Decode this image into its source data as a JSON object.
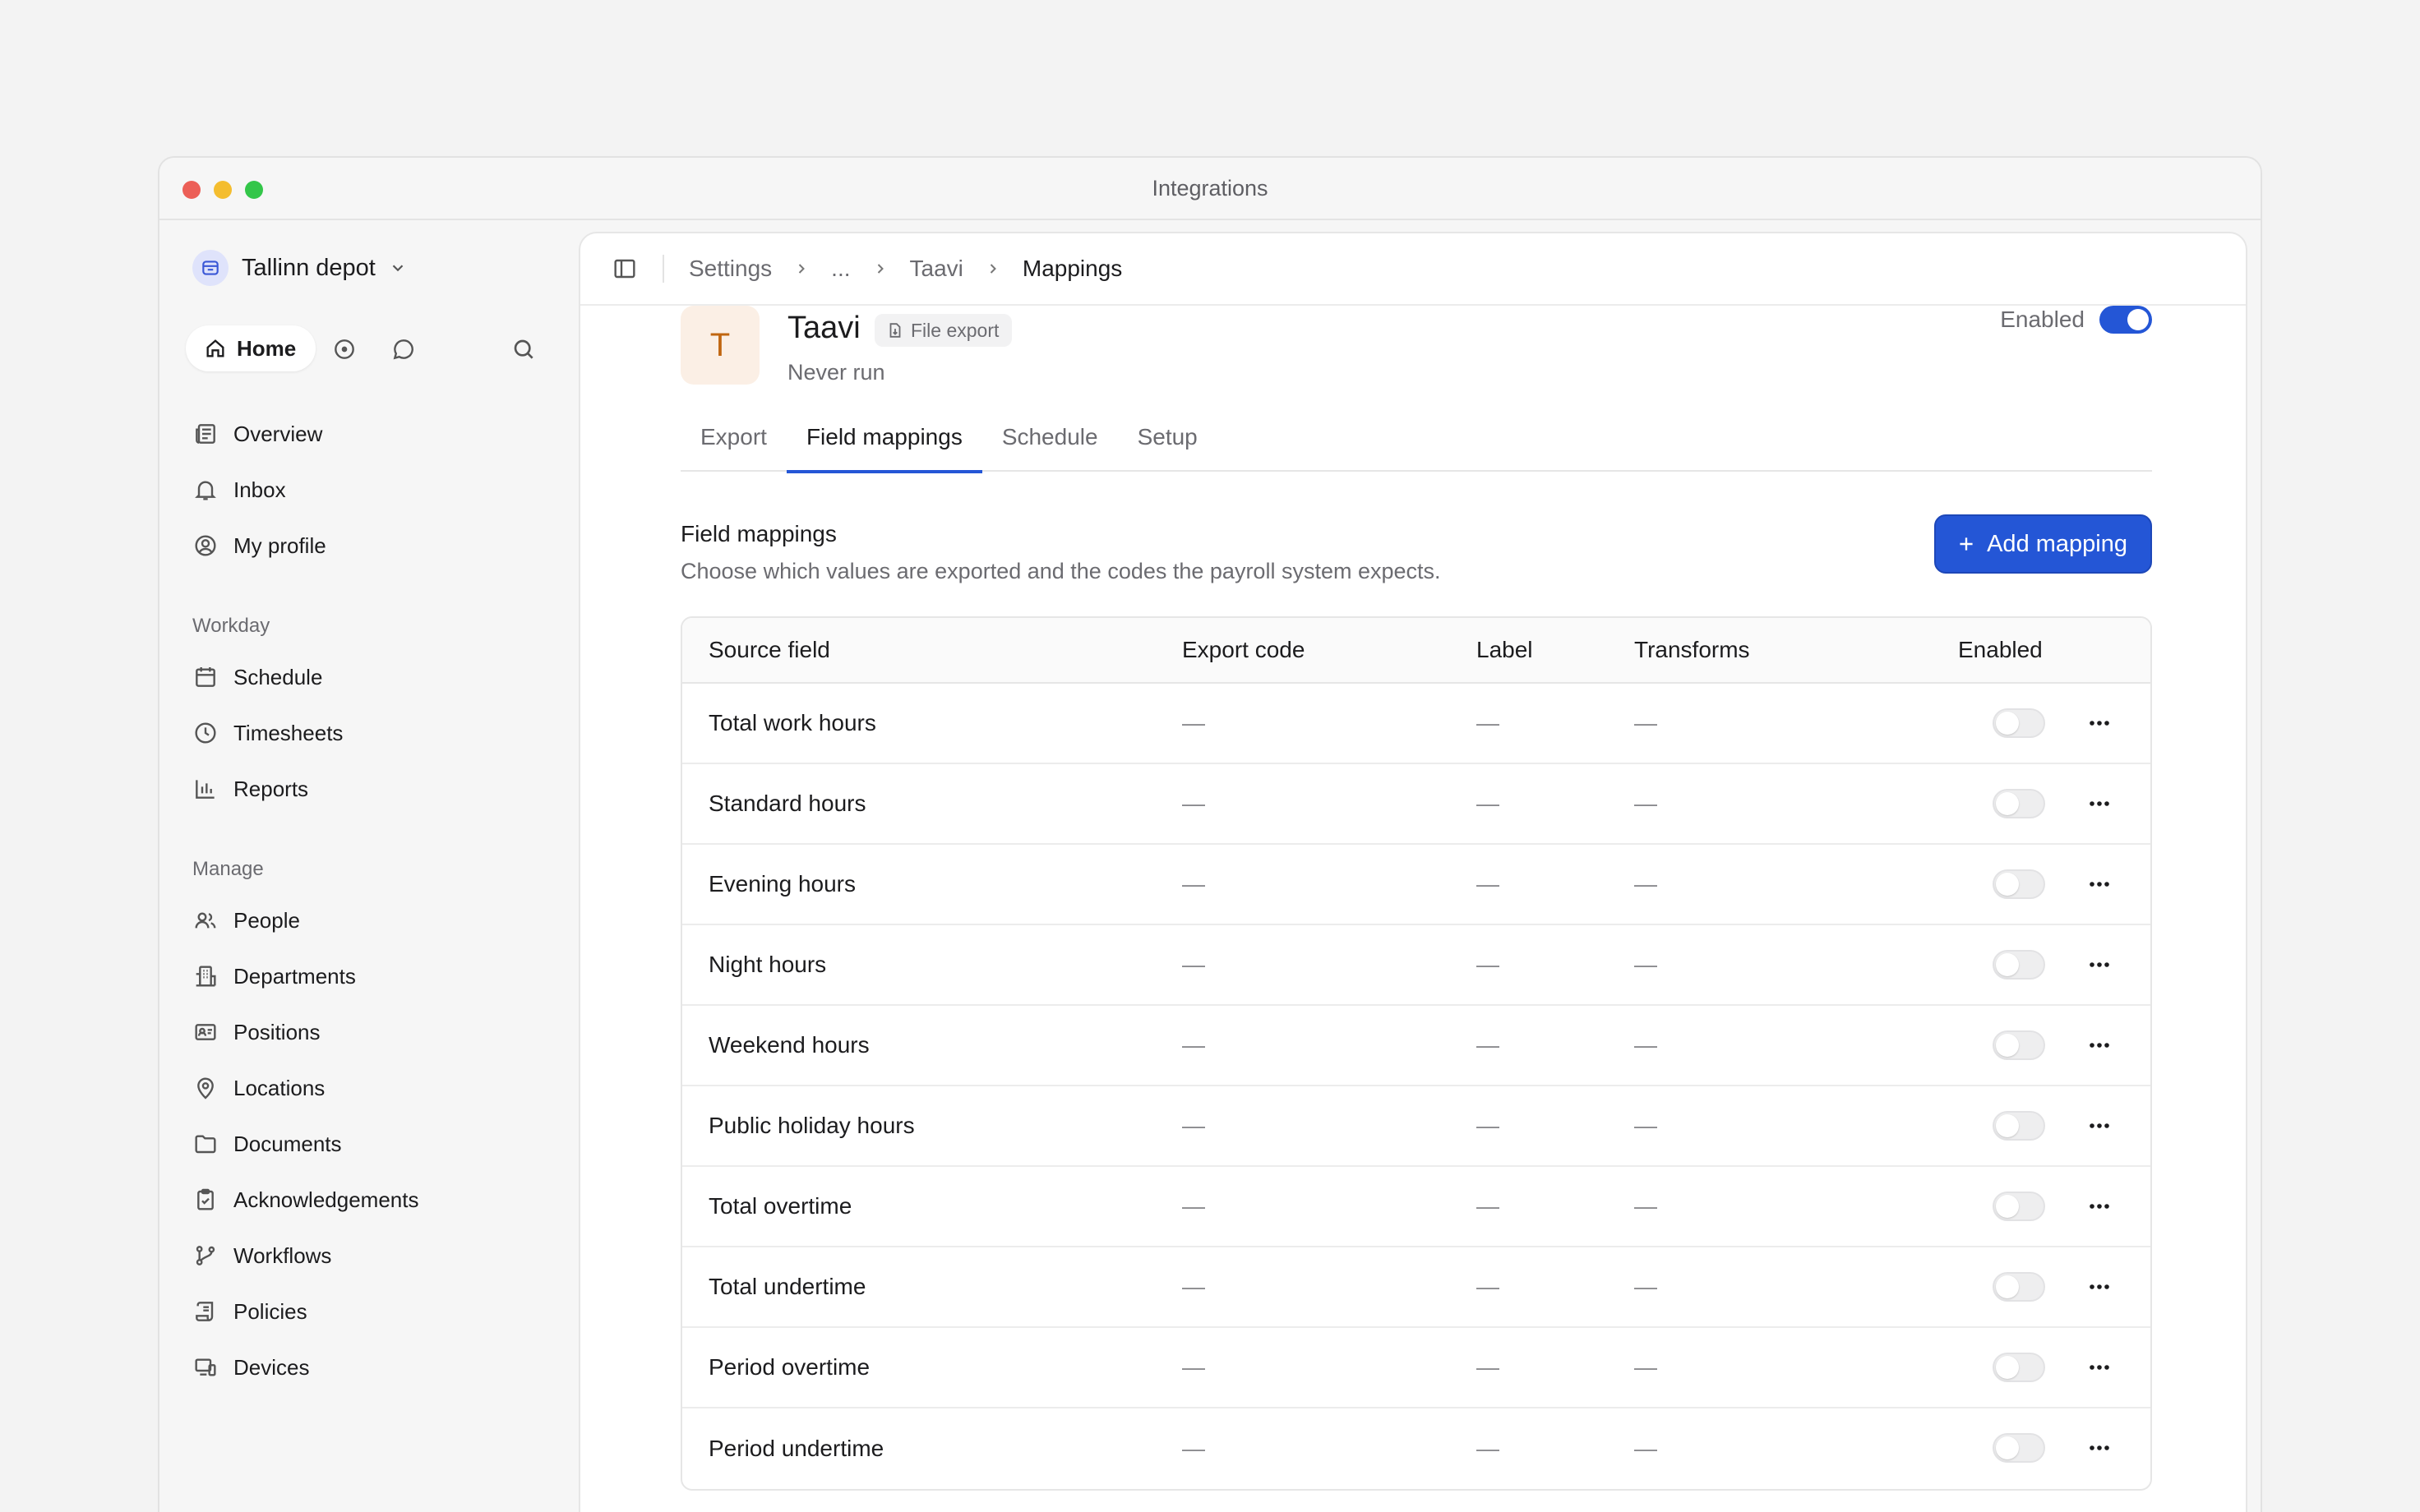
{
  "window": {
    "title": "Integrations"
  },
  "sidebar": {
    "workspace": "Tallinn depot",
    "home_label": "Home",
    "items_top": [
      {
        "label": "Overview",
        "icon": "newspaper-icon"
      },
      {
        "label": "Inbox",
        "icon": "bell-icon"
      },
      {
        "label": "My profile",
        "icon": "user-circle-icon"
      }
    ],
    "section_workday": "Workday",
    "items_workday": [
      {
        "label": "Schedule",
        "icon": "calendar-icon"
      },
      {
        "label": "Timesheets",
        "icon": "clock-icon"
      },
      {
        "label": "Reports",
        "icon": "bar-chart-icon"
      }
    ],
    "section_manage": "Manage",
    "items_manage": [
      {
        "label": "People",
        "icon": "people-icon"
      },
      {
        "label": "Departments",
        "icon": "building-icon"
      },
      {
        "label": "Positions",
        "icon": "id-card-icon"
      },
      {
        "label": "Locations",
        "icon": "map-pin-icon"
      },
      {
        "label": "Documents",
        "icon": "folder-icon"
      },
      {
        "label": "Acknowledgements",
        "icon": "clipboard-check-icon"
      },
      {
        "label": "Workflows",
        "icon": "git-branch-icon"
      },
      {
        "label": "Policies",
        "icon": "scroll-icon"
      },
      {
        "label": "Devices",
        "icon": "devices-icon"
      }
    ]
  },
  "breadcrumb": {
    "items": [
      "Settings",
      "...",
      "Taavi",
      "Mappings"
    ]
  },
  "integration": {
    "logo_letter": "T",
    "name": "Taavi",
    "badge": "File export",
    "status": "Never run",
    "enabled_label": "Enabled",
    "enabled": true
  },
  "tabs": [
    "Export",
    "Field mappings",
    "Schedule",
    "Setup"
  ],
  "active_tab": "Field mappings",
  "section": {
    "title": "Field mappings",
    "description": "Choose which values are exported and the codes the payroll system expects.",
    "add_button": "Add mapping"
  },
  "table": {
    "columns": [
      "Source field",
      "Export code",
      "Label",
      "Transforms",
      "Enabled"
    ],
    "rows": [
      {
        "source": "Total work hours",
        "code": "—",
        "label": "—",
        "transforms": "—",
        "enabled": false
      },
      {
        "source": "Standard hours",
        "code": "—",
        "label": "—",
        "transforms": "—",
        "enabled": false
      },
      {
        "source": "Evening hours",
        "code": "—",
        "label": "—",
        "transforms": "—",
        "enabled": false
      },
      {
        "source": "Night hours",
        "code": "—",
        "label": "—",
        "transforms": "—",
        "enabled": false
      },
      {
        "source": "Weekend hours",
        "code": "—",
        "label": "—",
        "transforms": "—",
        "enabled": false
      },
      {
        "source": "Public holiday hours",
        "code": "—",
        "label": "—",
        "transforms": "—",
        "enabled": false
      },
      {
        "source": "Total overtime",
        "code": "—",
        "label": "—",
        "transforms": "—",
        "enabled": false
      },
      {
        "source": "Total undertime",
        "code": "—",
        "label": "—",
        "transforms": "—",
        "enabled": false
      },
      {
        "source": "Period overtime",
        "code": "—",
        "label": "—",
        "transforms": "—",
        "enabled": false
      },
      {
        "source": "Period undertime",
        "code": "—",
        "label": "—",
        "transforms": "—",
        "enabled": false
      }
    ]
  },
  "colors": {
    "accent": "#2456d6",
    "logo_bg": "#fbefe5",
    "logo_fg": "#c0650f"
  }
}
